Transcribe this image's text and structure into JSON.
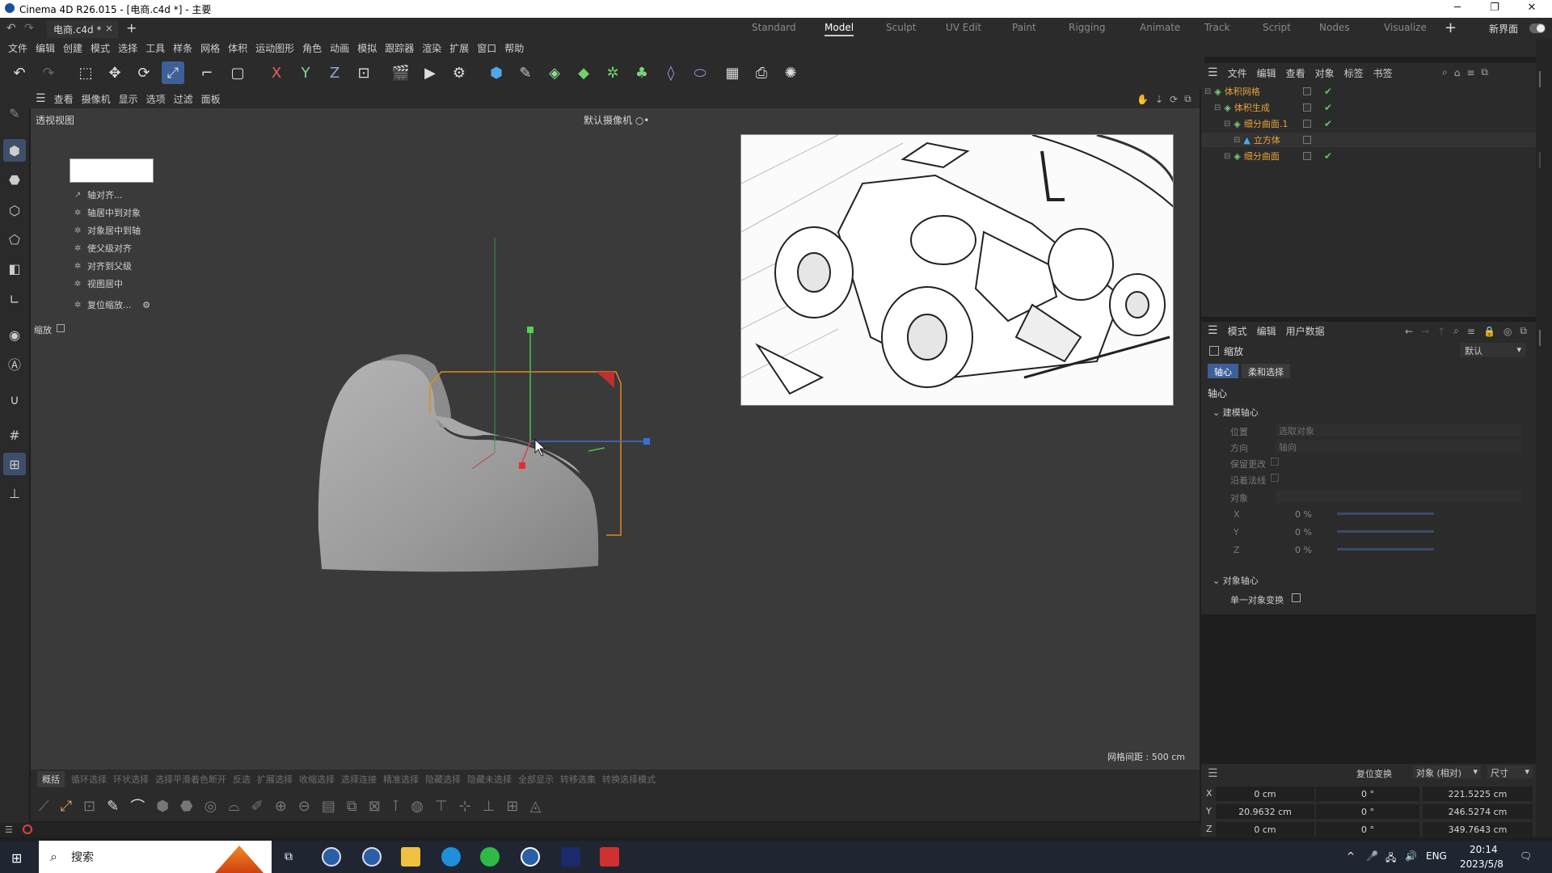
{
  "window": {
    "title": "Cinema 4D R26.015 - [电商.c4d *] - 主要",
    "minimize": "─",
    "restore": "❐",
    "close": "✕"
  },
  "tabs": {
    "doc_tab": "电商.c4d *",
    "doc_close": "×",
    "add": "+",
    "layouts": [
      "Standard",
      "Model",
      "Sculpt",
      "UV Edit",
      "Paint",
      "Rigging",
      "Animate",
      "Track",
      "Script",
      "Nodes",
      "Visualize"
    ],
    "active_layout": "Model",
    "new_ui": "新界面"
  },
  "menu": [
    "文件",
    "编辑",
    "创建",
    "模式",
    "选择",
    "工具",
    "样条",
    "网格",
    "体积",
    "运动图形",
    "角色",
    "动画",
    "模拟",
    "跟踪器",
    "渲染",
    "扩展",
    "窗口",
    "帮助"
  ],
  "toolbar": {
    "axis_labels": [
      "X",
      "Y",
      "Z"
    ]
  },
  "viewport": {
    "menu": [
      "查看",
      "摄像机",
      "显示",
      "选项",
      "过滤",
      "面板"
    ],
    "label": "透视视图",
    "camera": "默认摄像机 ○•",
    "grid_spacing": "网格间距 : 500 cm",
    "scale_label": "缩放"
  },
  "axis_popup": {
    "items": [
      "轴对齐...",
      "轴居中到对象",
      "对象居中到轴",
      "使父级对齐",
      "对齐到父级",
      "视图居中",
      "复位缩放..."
    ]
  },
  "bottom": {
    "tabs": [
      "概括",
      "循环选择",
      "环状选择",
      "选择平滑着色断开",
      "反选",
      "扩展选择",
      "收缩选择",
      "选择连接",
      "精准选择",
      "隐藏选择",
      "隐藏未选择",
      "全部显示",
      "转移选集",
      "转换选择模式"
    ],
    "active_tab": "概括"
  },
  "object_manager": {
    "menu": [
      "文件",
      "编辑",
      "查看",
      "对象",
      "标签",
      "书签"
    ],
    "objects": [
      {
        "name": "体积网格",
        "indent": 0
      },
      {
        "name": "体积生成",
        "indent": 1
      },
      {
        "name": "细分曲面.1",
        "indent": 2
      },
      {
        "name": "立方体",
        "indent": 3
      },
      {
        "name": "细分曲面",
        "indent": 2
      }
    ]
  },
  "attributes": {
    "menu": [
      "模式",
      "编辑",
      "用户数据"
    ],
    "title": "缩放",
    "preset": "默认",
    "tabs": [
      "轴心",
      "柔和选择"
    ],
    "section": "轴心",
    "group1": "建模轴心",
    "position_label": "位置",
    "position_value": "选取对象",
    "orientation_label": "方向",
    "orientation_value": "轴向",
    "keep_changes": "保留更改",
    "along_normal": "沿着法线",
    "object_label": "对象",
    "axes": [
      {
        "axis": "X",
        "value": "0 %"
      },
      {
        "axis": "Y",
        "value": "0 %"
      },
      {
        "axis": "Z",
        "value": "0 %"
      }
    ],
    "group2": "对象轴心",
    "single_transform": "单一对象变换"
  },
  "coordinates": {
    "reset": "复位变换",
    "mode": "对象 (相对)",
    "size_mode": "尺寸",
    "rows": [
      {
        "axis": "X",
        "pos": "0 cm",
        "rot": "0 °",
        "size": "221.5225 cm"
      },
      {
        "axis": "Y",
        "pos": "20.9632 cm",
        "rot": "0 °",
        "size": "246.5274 cm"
      },
      {
        "axis": "Z",
        "pos": "0 cm",
        "rot": "0 °",
        "size": "349.7643 cm"
      }
    ]
  },
  "taskbar": {
    "search": "搜索",
    "lang": "ENG",
    "time": "20:14",
    "date": "2023/5/8"
  }
}
